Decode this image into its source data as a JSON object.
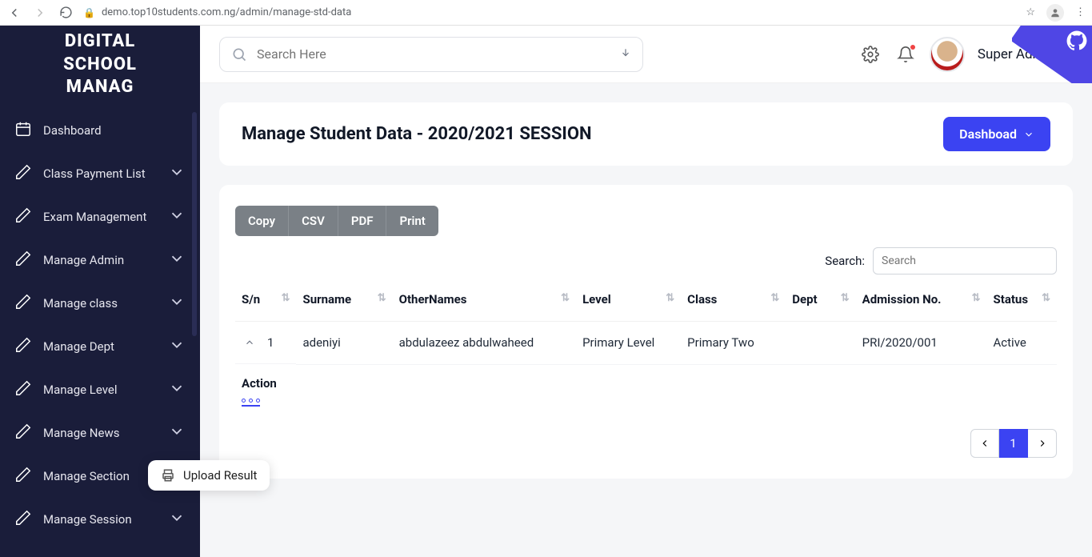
{
  "browser": {
    "url": "demo.top10students.com.ng/admin/manage-std-data"
  },
  "sidebar": {
    "brand_line1": "DIGITAL",
    "brand_line2": "SCHOOL",
    "brand_line3": "MANAG",
    "items": [
      {
        "label": "Dashboard",
        "expandable": false
      },
      {
        "label": "Class Payment List",
        "expandable": true
      },
      {
        "label": "Exam Management",
        "expandable": true
      },
      {
        "label": "Manage Admin",
        "expandable": true
      },
      {
        "label": "Manage class",
        "expandable": true
      },
      {
        "label": "Manage Dept",
        "expandable": true
      },
      {
        "label": "Manage Level",
        "expandable": true
      },
      {
        "label": "Manage News",
        "expandable": true
      },
      {
        "label": "Manage Section",
        "expandable": true
      },
      {
        "label": "Manage Session",
        "expandable": true
      }
    ]
  },
  "popover": {
    "label": "Upload Result"
  },
  "topbar": {
    "search_placeholder": "Search Here",
    "user_name": "Super Admin"
  },
  "header": {
    "title": "Manage Student Data - 2020/2021 SESSION",
    "button": "Dashboad"
  },
  "export_buttons": [
    "Copy",
    "CSV",
    "PDF",
    "Print"
  ],
  "table": {
    "search_label": "Search:",
    "search_placeholder": "Search",
    "columns": [
      "S/n",
      "Surname",
      "OtherNames",
      "Level",
      "Class",
      "Dept",
      "Admission No.",
      "Status"
    ],
    "rows": [
      {
        "sn": "1",
        "surname": "adeniyi",
        "other_names": "abdulazeez abdulwaheed",
        "level": "Primary Level",
        "class": "Primary Two",
        "dept": "",
        "admission_no": "PRI/2020/001",
        "status": "Active"
      }
    ],
    "action_label": "Action",
    "pages": [
      "1"
    ]
  }
}
